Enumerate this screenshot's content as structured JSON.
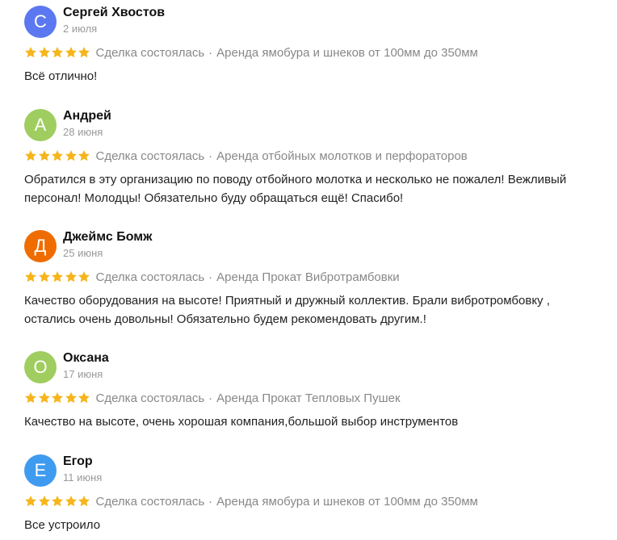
{
  "colors": {
    "star": "#f5b51b",
    "muted": "#888888",
    "text": "#222222"
  },
  "reviews": [
    {
      "initial": "С",
      "avatar_color": "#5b78f0",
      "author": "Сергей Хвостов",
      "date": "2 июля",
      "rating": 5,
      "deal_status": "Сделка состоялась",
      "separator": "·",
      "service": "Аренда ямобура и шнеков от 100мм до 350мм",
      "text": "Всё отлично!"
    },
    {
      "initial": "А",
      "avatar_color": "#9fcd5f",
      "author": "Андрей",
      "date": "28 июня",
      "rating": 5,
      "deal_status": "Сделка состоялась",
      "separator": "·",
      "service": "Аренда отбойных молотков и перфораторов",
      "text": "Обратился в эту организацию по поводу отбойного молотка и несколько не пожалел! Вежливый персонал! Молодцы! Обязательно буду обращаться ещё! Спасибо!"
    },
    {
      "initial": "Д",
      "avatar_color": "#ef6c00",
      "author": "Джеймс Бомж",
      "date": "25 июня",
      "rating": 5,
      "deal_status": "Сделка состоялась",
      "separator": "·",
      "service": "Аренда Прокат Вибротрамбовки",
      "text": "Качество оборудования на высоте! Приятный и дружный коллектив. Брали вибротромбовку , остались очень довольны! Обязательно будем рекомендовать другим.!"
    },
    {
      "initial": "О",
      "avatar_color": "#9fcd5f",
      "author": "Оксана",
      "date": "17 июня",
      "rating": 5,
      "deal_status": "Сделка состоялась",
      "separator": "·",
      "service": "Аренда Прокат Тепловых Пушек",
      "text": "Качество на высоте, очень хорошая компания,большой выбор инструментов"
    },
    {
      "initial": "Е",
      "avatar_color": "#3f9bef",
      "author": "Егор",
      "date": "11 июня",
      "rating": 5,
      "deal_status": "Сделка состоялась",
      "separator": "·",
      "service": "Аренда ямобура и шнеков от 100мм до 350мм",
      "text": "Все устроило"
    }
  ]
}
